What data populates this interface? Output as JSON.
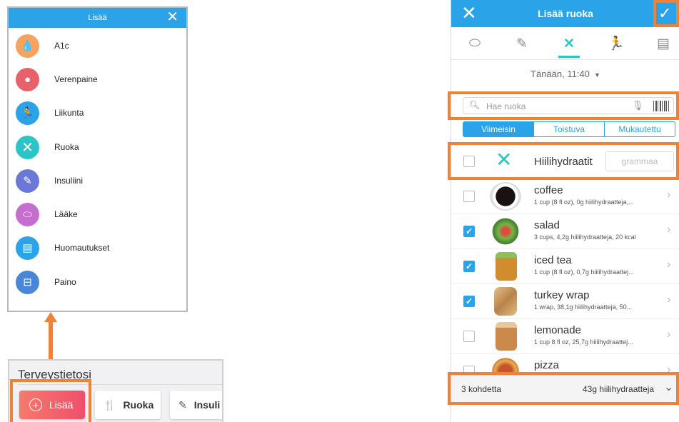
{
  "menu": {
    "title": "Lisää",
    "close_icon": "close-icon",
    "items": [
      {
        "label": "A1c",
        "icon": "drop-icon",
        "color": "#f5a35f"
      },
      {
        "label": "Verenpaine",
        "icon": "blood-drop-icon",
        "color": "#e8606a"
      },
      {
        "label": "Liikunta",
        "icon": "running-icon",
        "color": "#2aa3e8"
      },
      {
        "label": "Ruoka",
        "icon": "fork-knife-icon",
        "color": "#2bc5c8"
      },
      {
        "label": "Insuliini",
        "icon": "syringe-icon",
        "color": "#6a79d8"
      },
      {
        "label": "Lääke",
        "icon": "pill-icon",
        "color": "#c66dd0"
      },
      {
        "label": "Huomautukset",
        "icon": "notes-icon",
        "color": "#2aa3e8"
      },
      {
        "label": "Paino",
        "icon": "scale-icon",
        "color": "#4a86d8"
      }
    ]
  },
  "bottom_bar": {
    "title": "Terveystietosi",
    "add_label": "Lisää",
    "food_label": "Ruoka",
    "insulin_label": "Insuli"
  },
  "food_screen": {
    "title": "Lisää ruoka",
    "tabs": [
      "pill-icon",
      "syringe-icon",
      "fork-knife-icon",
      "running-icon",
      "notes-icon"
    ],
    "active_tab": "fork-knife-icon",
    "datetime": "Tänään, 11:40",
    "search_placeholder": "Hae ruoka",
    "segments": [
      "Viimeisin",
      "Toistuva",
      "Mukautettu"
    ],
    "active_segment": "Viimeisin",
    "carb_label": "Hiilihydraatit",
    "grams_placeholder": "grammaa",
    "foods": [
      {
        "name": "coffee",
        "desc": "1 cup (8 fl oz), 0g hiilihydraatteja,...",
        "checked": false,
        "color": "#3a2a22"
      },
      {
        "name": "salad",
        "desc": "3 cups, 4,2g hiilihydraatteja, 20 kcal",
        "checked": true,
        "color": "#6aa84f"
      },
      {
        "name": "iced tea",
        "desc": "1 cup (8 fl oz), 0,7g hiilihydraattej...",
        "checked": true,
        "color": "#c9862c"
      },
      {
        "name": "turkey wrap",
        "desc": "1 wrap, 38,1g hiilihydraatteja, 50...",
        "checked": true,
        "color": "#d7a968"
      },
      {
        "name": "lemonade",
        "desc": "1 cup 8 fl oz, 25,7g hiilihydraattej...",
        "checked": false,
        "color": "#c98a4b"
      },
      {
        "name": "pizza",
        "desc": "",
        "checked": false,
        "color": "#c7532e"
      }
    ],
    "footer_count": "3 kohdetta",
    "footer_sum": "43g hiilihydraatteja"
  },
  "accent_color": "#2aa3e8",
  "highlight_color": "#f08135"
}
